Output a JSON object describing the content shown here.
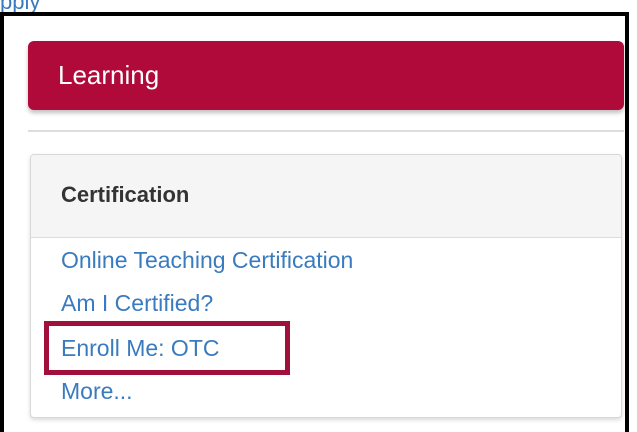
{
  "top_link": "pply",
  "learning": {
    "title": "Learning"
  },
  "certification": {
    "title": "Certification",
    "links": [
      "Online Teaching Certification",
      "Am I Certified?",
      "Enroll Me: OTC",
      "More..."
    ]
  },
  "colors": {
    "header_bg": "#b00a3a",
    "link": "#3a7bbf",
    "highlight": "#a0103a"
  }
}
